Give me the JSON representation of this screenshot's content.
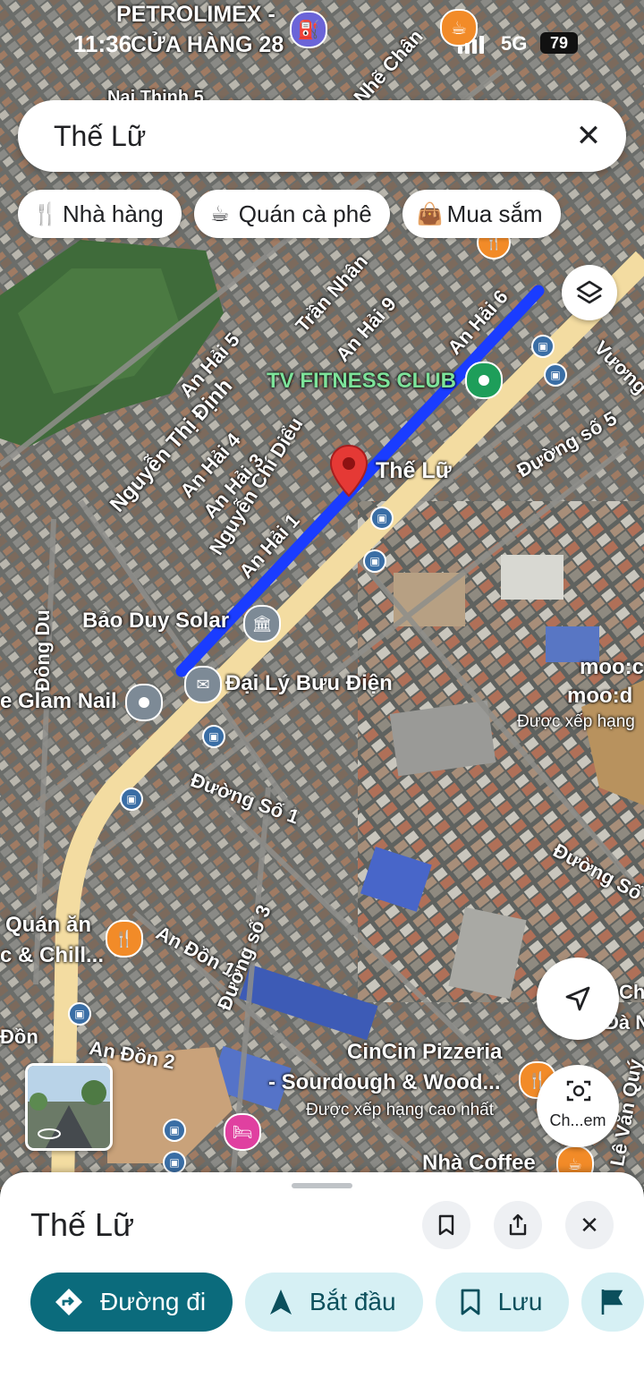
{
  "status_bar": {
    "time": "11:36",
    "network": "5G",
    "battery": "79"
  },
  "search": {
    "query": "Thế Lữ"
  },
  "chips": [
    {
      "label": "Nhà hàng",
      "icon": "fork-knife-icon"
    },
    {
      "label": "Quán cà phê",
      "icon": "coffee-icon"
    },
    {
      "label": "Mua sắm",
      "icon": "shopping-bag-icon"
    }
  ],
  "map": {
    "places": {
      "petrolimex": "PETROLIMEX -",
      "petrolimex2": "CỬA HÀNG 28",
      "fitness": "TV FITNESS CLUB",
      "selected_street": "Thế Lữ",
      "solar": "Bảo Duy Solar",
      "post": "Đại Lý Bưu Điện",
      "nail": "e Glam Nail",
      "quan_an": "Quán ăn",
      "chill": "c & Chill...",
      "cincin1": "CinCin Pizzeria",
      "cincin2": "- Sourdough & Wood...",
      "cincin_sub": "Được xếp hạng cao nhất",
      "moo1": "moo:c",
      "moo2": "moo:d",
      "moo_sub": "Được xếp hạng",
      "coffee": "Nhà Coffee",
      "nhi": "Nại Thịnh 5"
    },
    "streets": {
      "an_hai_5": "An Hải 5",
      "an_hai_4": "An Hải 4",
      "an_hai_3": "An Hải 3",
      "an_hai_1": "An Hải 1",
      "an_hai_6": "An Hải 6",
      "an_hai_9": "An Hải 9",
      "nguyen_thi_dinh": "Nguyễn Thị Định",
      "nguyen_chi_dieu": "Nguyễn Chí Diểu",
      "tran_nhan": "Trần Nhân",
      "dong_du": "Đông Du",
      "duong_so_5": "Đường số 5",
      "duong_so_1": "Đường Số 1",
      "duong_so_3": "Đường số 3",
      "duong_so_right": "Đường Số",
      "an_don_1": "An Đồn 1",
      "an_don_2": "An Đồn 2",
      "don": "Đồn",
      "vuong": "Vương",
      "le_van_quy": "Lê Văn Quý",
      "nhe_chan": "Nhẽ Chân",
      "ch": "Ch",
      "da_n": "Đà N"
    }
  },
  "lens_button": {
    "label": "Ch...em"
  },
  "sheet": {
    "title": "Thế Lữ",
    "actions": [
      {
        "label": "Đường đi",
        "icon": "directions-icon"
      },
      {
        "label": "Bắt đầu",
        "icon": "navigation-arrow-icon"
      },
      {
        "label": "Lưu",
        "icon": "bookmark-icon"
      }
    ]
  },
  "colors": {
    "route": "#1a3cff",
    "main_road": "#f3dca1",
    "primary_action": "#0b6b7c",
    "secondary_action": "#d6f0f4",
    "pin_red": "#e53935"
  }
}
